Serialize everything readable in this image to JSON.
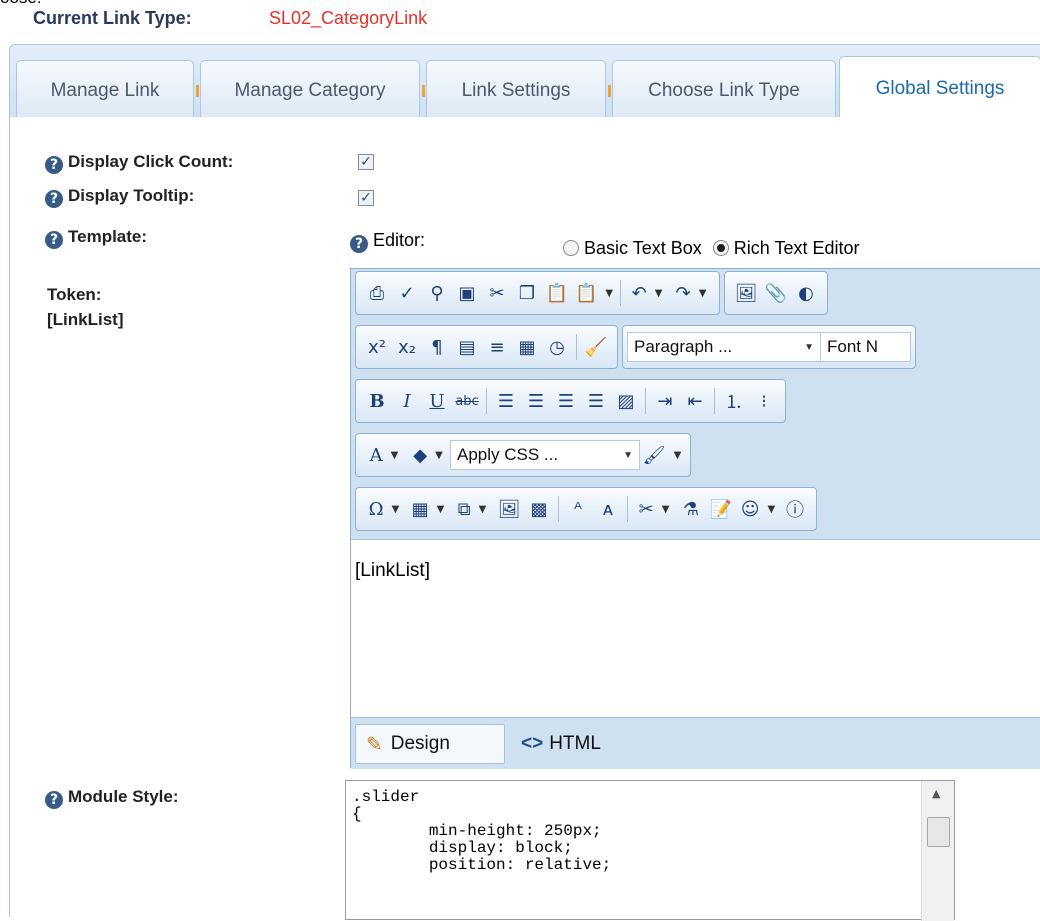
{
  "header": {
    "cut_text": "oose:",
    "current_link_type_label": "Current Link Type:",
    "current_link_type_value": "SL02_CategoryLink"
  },
  "tabs": [
    {
      "label": "Manage Link",
      "active": false
    },
    {
      "label": "Manage Category",
      "active": false
    },
    {
      "label": "Link Settings",
      "active": false
    },
    {
      "label": "Choose Link Type",
      "active": false
    },
    {
      "label": "Global Settings",
      "active": true
    }
  ],
  "settings": {
    "display_click_count": {
      "label": "Display Click Count:",
      "checked": true
    },
    "display_tooltip": {
      "label": "Display Tooltip:",
      "checked": true
    },
    "template": {
      "label": "Template:"
    },
    "editor_label": "Editor:",
    "editor_options": [
      {
        "label": "Basic Text Box",
        "selected": false
      },
      {
        "label": "Rich Text Editor",
        "selected": true
      }
    ],
    "token_label": "Token:",
    "token_value": "[LinkList]",
    "module_style_label": "Module Style:"
  },
  "editor": {
    "format_select": "Paragraph ...",
    "font_select": "Font N",
    "css_select": "Apply CSS ...",
    "content": "[LinkList]",
    "modes": {
      "design": "Design",
      "html": "HTML"
    },
    "toolbar_glyphs": {
      "bold": "B",
      "italic": "I",
      "underline": "U",
      "strike": "abc",
      "superscript": "x²",
      "subscript": "x₂",
      "font_color": "A",
      "special_char": "Ω"
    }
  },
  "module_style": {
    "code": ".slider\n{\n        min-height: 250px;\n        display: block;\n        position: relative;"
  },
  "colors": {
    "accent_red": "#e8302a",
    "tab_active_text": "#1a6aa8",
    "help_icon": "#375a86"
  }
}
